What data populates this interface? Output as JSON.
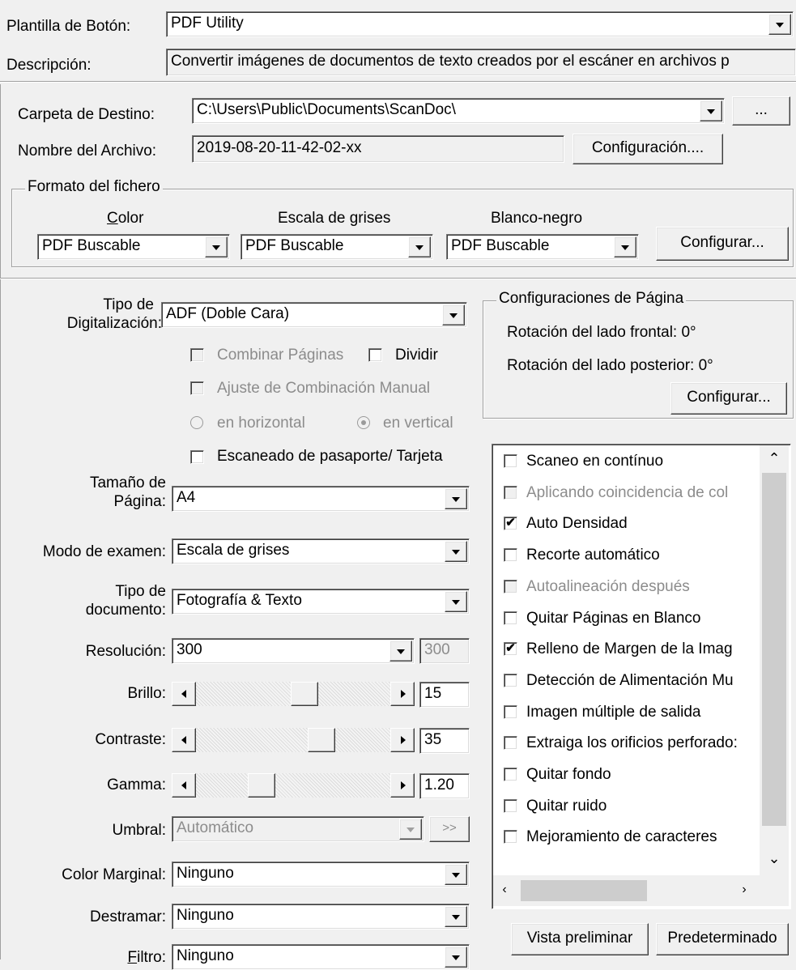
{
  "template": {
    "label": "Plantilla de Botón:",
    "value": "PDF Utility",
    "desc_label": "Descripción:",
    "desc_value": "Convertir imágenes de documentos de texto creados por el escáner en archivos p"
  },
  "destination": {
    "folder_label": "Carpeta de Destino:",
    "folder_value": "C:\\Users\\Public\\Documents\\ScanDoc\\",
    "browse_label": "...",
    "filename_label": "Nombre del Archivo:",
    "filename_value": "2019-08-20-11-42-02-xx",
    "config_label": "Configuración...."
  },
  "file_format": {
    "group_title": "Formato del fichero",
    "color_label": "Color",
    "gray_label": "Escala de grises",
    "bw_label": "Blanco-negro",
    "color_value": "PDF Buscable",
    "gray_value": "PDF Buscable",
    "bw_value": "PDF Buscable",
    "configure_label": "Configurar..."
  },
  "scan": {
    "type_label_1": "Tipo de",
    "type_label_2": "Digitalización:",
    "type_value": "ADF (Doble Cara)",
    "combine_pages": "Combinar Páginas",
    "split": "Dividir",
    "manual_combine": "Ajuste de Combinación Manual",
    "horizontal": "en horizontal",
    "vertical": "en vertical",
    "passport": "Escaneado de pasaporte/ Tarjeta",
    "page_size_label_1": "Tamaño de",
    "page_size_label_2": "Página:",
    "page_size_value": "A4",
    "mode_label": "Modo de examen:",
    "mode_value": "Escala de grises",
    "doc_type_label_1": "Tipo de",
    "doc_type_label_2": "documento:",
    "doc_type_value": "Fotografía & Texto",
    "resolution_label": "Resolución:",
    "resolution_value": "300",
    "resolution_custom": "300",
    "brightness_label": "Brillo:",
    "brightness_value": "15",
    "brightness_level": 0.57,
    "contrast_label": "Contraste:",
    "contrast_value": "35",
    "contrast_level": 0.67,
    "gamma_label": "Gamma:",
    "gamma_value": "1.20",
    "gamma_level": 0.31,
    "threshold_label": "Umbral:",
    "threshold_value": "Automático",
    "threshold_more": ">>",
    "edge_color_label": "Color Marginal:",
    "edge_color_value": "Ninguno",
    "descreen_label": "Destramar:",
    "descreen_value": "Ninguno",
    "filter_label": "Filtro:",
    "filter_value": "Ninguno"
  },
  "page_config": {
    "group_title": "Configuraciones de Página",
    "front_rotation": "Rotación del lado frontal: 0°",
    "back_rotation": "Rotación del lado posterior: 0°",
    "configure_label": "Configurar..."
  },
  "options": [
    {
      "label": "Scaneo en contínuo",
      "checked": false,
      "disabled": false
    },
    {
      "label": "Aplicando coincidencia de col",
      "checked": false,
      "disabled": true
    },
    {
      "label": "Auto Densidad",
      "checked": true,
      "disabled": false
    },
    {
      "label": "Recorte automático",
      "checked": false,
      "disabled": false
    },
    {
      "label": "Autoalineación después",
      "checked": false,
      "disabled": true
    },
    {
      "label": "Quitar Páginas en Blanco",
      "checked": false,
      "disabled": false
    },
    {
      "label": "Relleno de Margen de la Imag",
      "checked": true,
      "disabled": false
    },
    {
      "label": "Detección de Alimentación Mu",
      "checked": false,
      "disabled": false
    },
    {
      "label": "Imagen múltiple de salida",
      "checked": false,
      "disabled": false
    },
    {
      "label": "Extraiga los orificios perforado:",
      "checked": false,
      "disabled": false
    },
    {
      "label": "Quitar fondo",
      "checked": false,
      "disabled": false
    },
    {
      "label": "Quitar ruido",
      "checked": false,
      "disabled": false
    },
    {
      "label": "Mejoramiento de caracteres",
      "checked": false,
      "disabled": false
    }
  ],
  "buttons": {
    "preview": "Vista preliminar",
    "default": "Predeterminado"
  }
}
